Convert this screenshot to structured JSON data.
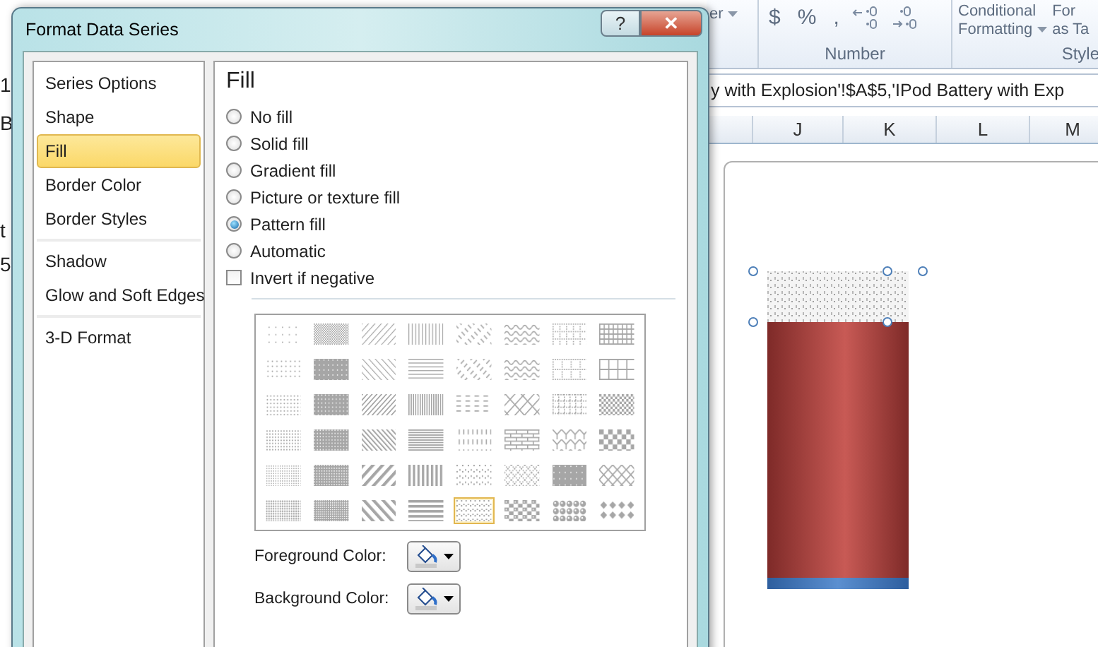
{
  "window": {
    "title": "Format Data Series",
    "help_button": "?",
    "close_button": "✕"
  },
  "sidebar": {
    "groups": [
      [
        {
          "label": "Series Options",
          "selected": false
        },
        {
          "label": "Shape",
          "selected": false
        },
        {
          "label": "Fill",
          "selected": true
        },
        {
          "label": "Border Color",
          "selected": false
        },
        {
          "label": "Border Styles",
          "selected": false
        }
      ],
      [
        {
          "label": "Shadow",
          "selected": false
        },
        {
          "label": "Glow and Soft Edges",
          "selected": false
        }
      ],
      [
        {
          "label": "3-D Format",
          "selected": false
        }
      ]
    ]
  },
  "fill": {
    "heading": "Fill",
    "options": [
      {
        "label": "No fill",
        "selected": false
      },
      {
        "label": "Solid fill",
        "selected": false
      },
      {
        "label": "Gradient fill",
        "selected": false
      },
      {
        "label": "Picture or texture fill",
        "selected": false
      },
      {
        "label": "Pattern fill",
        "selected": true
      },
      {
        "label": "Automatic",
        "selected": false
      }
    ],
    "invert_if_negative": {
      "label": "Invert if negative",
      "checked": false
    },
    "patterns": [
      {
        "selected": false
      },
      {
        "selected": false
      },
      {
        "selected": false
      },
      {
        "selected": false
      },
      {
        "selected": false
      },
      {
        "selected": false
      },
      {
        "selected": false
      },
      {
        "selected": false
      },
      {
        "selected": false
      },
      {
        "selected": false
      },
      {
        "selected": false
      },
      {
        "selected": false
      },
      {
        "selected": false
      },
      {
        "selected": false
      },
      {
        "selected": false
      },
      {
        "selected": false
      },
      {
        "selected": false
      },
      {
        "selected": false
      },
      {
        "selected": false
      },
      {
        "selected": false
      },
      {
        "selected": false
      },
      {
        "selected": false
      },
      {
        "selected": false
      },
      {
        "selected": false
      },
      {
        "selected": false
      },
      {
        "selected": false
      },
      {
        "selected": false
      },
      {
        "selected": false
      },
      {
        "selected": false
      },
      {
        "selected": false
      },
      {
        "selected": false
      },
      {
        "selected": false
      },
      {
        "selected": false
      },
      {
        "selected": false
      },
      {
        "selected": false
      },
      {
        "selected": false
      },
      {
        "selected": false
      },
      {
        "selected": false
      },
      {
        "selected": false
      },
      {
        "selected": false
      },
      {
        "selected": false
      },
      {
        "selected": false
      },
      {
        "selected": false
      },
      {
        "selected": false
      },
      {
        "selected": true
      },
      {
        "selected": false
      },
      {
        "selected": false
      },
      {
        "selected": false
      }
    ],
    "color_pickers": [
      {
        "label": "Foreground Color:"
      },
      {
        "label": "Background Color:"
      }
    ]
  },
  "excel": {
    "left_edge": [
      "1",
      "B",
      "t",
      "5"
    ],
    "ribbon": {
      "number_format_fragment": "er",
      "number_buttons": [
        "$",
        "%",
        ","
      ],
      "number_group_label": "Number",
      "conditional_formatting": [
        "Conditional",
        "Formatting"
      ],
      "format_as_table": [
        "For",
        "as Ta"
      ],
      "styles_group_label": "Style"
    },
    "formula_bar": "y with Explosion'!$A$5,'IPod Battery with Exp",
    "column_headers": [
      "J",
      "K",
      "L",
      "M"
    ]
  }
}
